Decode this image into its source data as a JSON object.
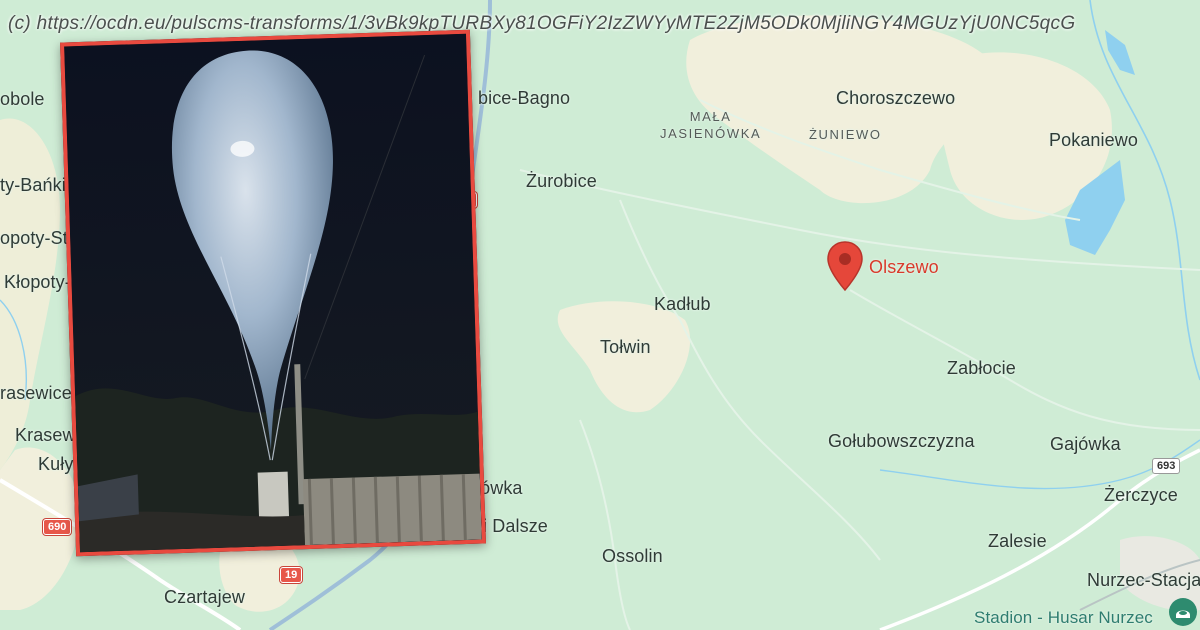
{
  "watermark": "(c) https://ocdn.eu/pulscms-transforms/1/3vBk9kpTURBXy81OGFiY2IzZWYyMTE2ZjM5ODk0MjliNGY4MGUzYjU0NC5qcG",
  "map": {
    "place_labels": [
      "obole",
      "bice-Bagno",
      "Choroszczewo",
      "Pokaniewo",
      "ty-Bańki",
      "Żurobice",
      "opoty-Stani",
      "Kłopoty-B",
      "Kadłub",
      "Tołwin",
      "Zabłocie",
      "rasewice-C",
      "Krasewic",
      "Kuływgi",
      "Gołubowszczyzna",
      "Gajówka",
      "nówka",
      "Żerczyce",
      "ki Dalsze",
      "Ossolin",
      "Zalesie",
      "Czartajew",
      "Nurzec-Stacja"
    ],
    "small_labels": {
      "mala_jasienowka_line1": "MAŁA",
      "mala_jasienowka_line2": "JASIENÓWKA",
      "zuniewo": "ŻUNIEWO"
    },
    "marker": {
      "name": "Olszewo",
      "icon": "map-pin-icon",
      "color": "#e5473a"
    },
    "poi": {
      "name": "Stadion - Husar Nurzec",
      "icon": "stadium-icon",
      "color": "#2e7d6f"
    },
    "road_shields": {
      "r19_top": "19",
      "r19_bottom": "19",
      "r690": "690",
      "r693": "693"
    }
  },
  "photo_inset": {
    "description_icon": "balloon-photo",
    "border_color": "#e84a3f"
  }
}
